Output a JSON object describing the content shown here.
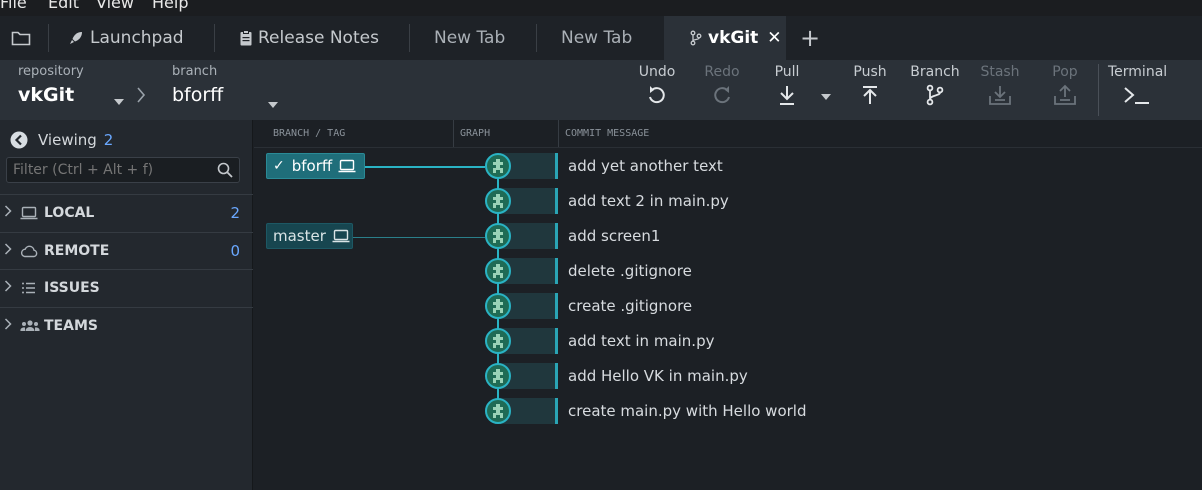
{
  "menubar": {
    "items": [
      "File",
      "Edit",
      "View",
      "Help"
    ]
  },
  "tabs": {
    "launchpad": "Launchpad",
    "release_notes": "Release Notes",
    "new_tab_1": "New Tab",
    "new_tab_2": "New Tab",
    "active": "vkGit",
    "add": "+"
  },
  "toolbar": {
    "repository_label": "repository",
    "repository_value": "vkGit",
    "branch_label": "branch",
    "branch_value": "bforff",
    "undo": "Undo",
    "redo": "Redo",
    "pull": "Pull",
    "push": "Push",
    "branch": "Branch",
    "stash": "Stash",
    "pop": "Pop",
    "terminal": "Terminal"
  },
  "sidebar": {
    "viewing_label": "Viewing",
    "viewing_count": "2",
    "filter_placeholder": "Filter (Ctrl + Alt + f)",
    "sections": [
      {
        "label": "LOCAL",
        "count": "2",
        "icon": "laptop-icon"
      },
      {
        "label": "REMOTE",
        "count": "0",
        "icon": "cloud-icon"
      },
      {
        "label": "ISSUES",
        "count": "",
        "icon": "list-icon"
      },
      {
        "label": "TEAMS",
        "count": "",
        "icon": "users-icon"
      }
    ]
  },
  "graph": {
    "columns": {
      "branch_tag": "BRANCH / TAG",
      "graph": "GRAPH",
      "commit_message": "COMMIT MESSAGE"
    },
    "branches": [
      {
        "name": "bforff",
        "checked_out": true
      },
      {
        "name": "master",
        "checked_out": false
      }
    ],
    "commits": [
      "add yet another text",
      "add text 2 in main.py",
      "add screen1",
      "delete .gitignore",
      "create .gitignore",
      "add text in main.py",
      "add Hello VK in main.py",
      "create main.py with Hello world"
    ]
  },
  "colors": {
    "accent": "#2ab3c4",
    "count": "#6aa8ff",
    "branch_active": "#1f6e7a",
    "branch_inactive": "#174650"
  }
}
